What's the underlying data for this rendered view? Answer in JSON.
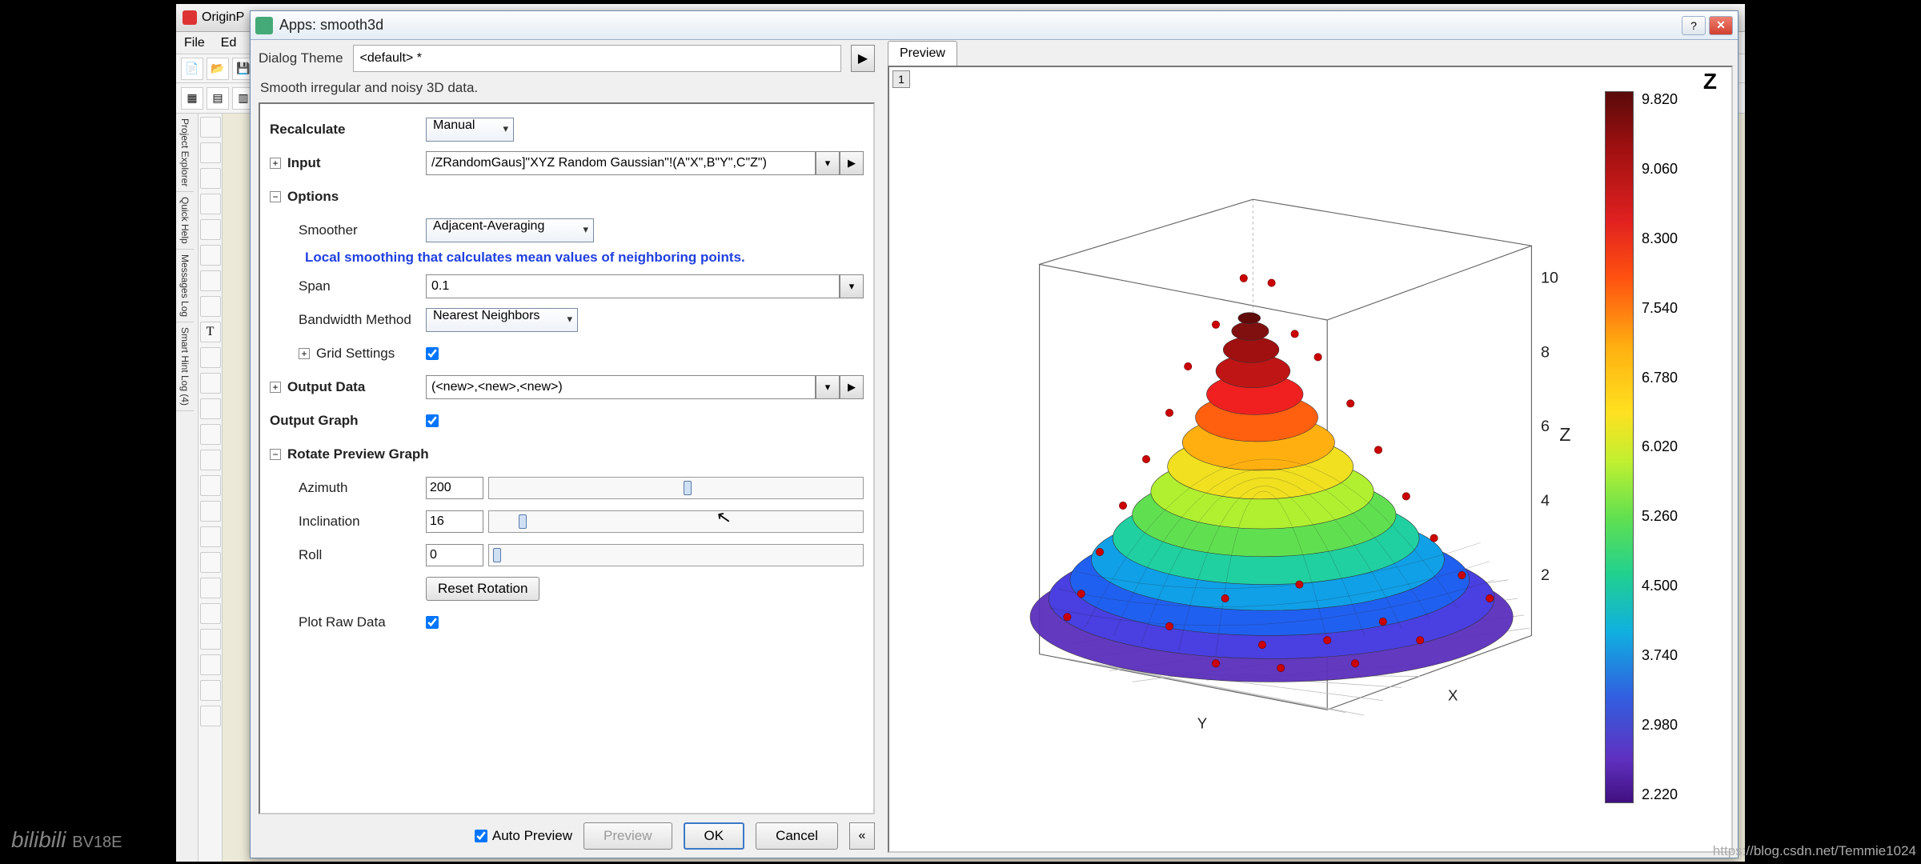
{
  "bg": {
    "appTitle": "OriginP",
    "menu": {
      "file": "File",
      "edit": "Ed"
    }
  },
  "dialog": {
    "title": "Apps: smooth3d",
    "themeLabel": "Dialog Theme",
    "themeValue": "<default> *",
    "description": "Smooth irregular and noisy 3D data.",
    "recalculateLabel": "Recalculate",
    "recalculateValue": "Manual",
    "inputLabel": "Input",
    "inputValue": "/ZRandomGaus]\"XYZ Random Gaussian\"!(A\"X\",B\"Y\",C\"Z\")",
    "optionsLabel": "Options",
    "smootherLabel": "Smoother",
    "smootherValue": "Adjacent-Averaging",
    "smootherHint": "Local smoothing that calculates mean values of neighboring points.",
    "spanLabel": "Span",
    "spanValue": "0.1",
    "bandwidthLabel": "Bandwidth Method",
    "bandwidthValue": "Nearest Neighbors",
    "gridSettingsLabel": "Grid Settings",
    "gridSettingsChecked": true,
    "outputDataLabel": "Output Data",
    "outputDataValue": "(<new>,<new>,<new>)",
    "outputGraphLabel": "Output Graph",
    "outputGraphChecked": true,
    "rotateLabel": "Rotate Preview Graph",
    "azimuthLabel": "Azimuth",
    "azimuthValue": "200",
    "azimuthPos": 52,
    "inclinationLabel": "Inclination",
    "inclinationValue": "16",
    "inclinationPos": 8,
    "rollLabel": "Roll",
    "rollValue": "0",
    "rollPos": 1,
    "resetRotationLabel": "Reset Rotation",
    "plotRawLabel": "Plot Raw Data",
    "plotRawChecked": true,
    "autoPreviewLabel": "Auto Preview",
    "autoPreviewChecked": true,
    "previewBtn": "Preview",
    "okBtn": "OK",
    "cancelBtn": "Cancel",
    "previewTab": "Preview",
    "cornerTab": "1"
  },
  "colorbar": {
    "title": "Z",
    "ticks": [
      "9.820",
      "9.060",
      "8.300",
      "7.540",
      "6.780",
      "6.020",
      "5.260",
      "4.500",
      "3.740",
      "2.980",
      "2.220"
    ]
  },
  "axisTicks": {
    "z": [
      "10",
      "8",
      "6",
      "4",
      "2"
    ],
    "zlabel": "Z"
  },
  "watermark": {
    "logo": "bilibili",
    "bv": "BV18E"
  },
  "csdn": "https://blog.csdn.net/Temmie1024",
  "sidebarTabs": [
    "Project Explorer",
    "Quick Help",
    "Messages Log",
    "Smart Hint Log (4)"
  ]
}
